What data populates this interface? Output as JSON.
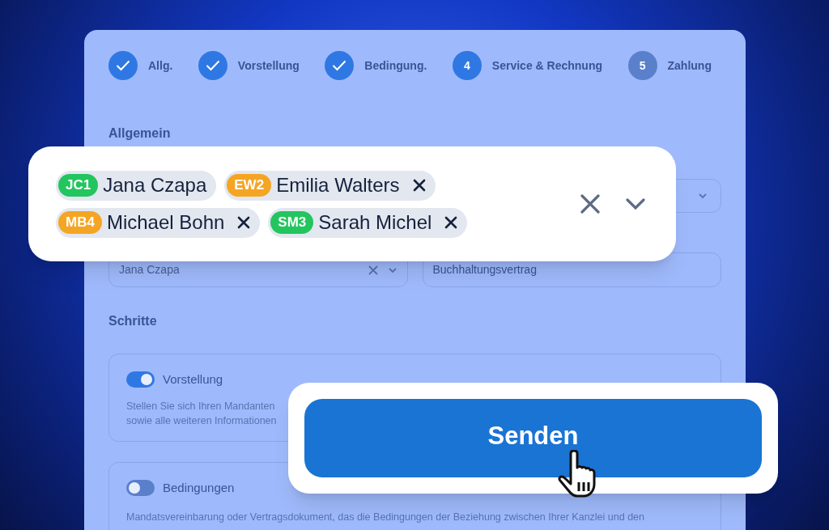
{
  "steps": [
    {
      "kind": "done",
      "label": "Allg."
    },
    {
      "kind": "done",
      "label": "Vorstellung"
    },
    {
      "kind": "done",
      "label": "Bedingung."
    },
    {
      "kind": "current",
      "number": "4",
      "label": "Service & Rechnung"
    },
    {
      "kind": "pending",
      "number": "5",
      "label": "Zahlung"
    }
  ],
  "general": {
    "heading": "Allgemein",
    "contact_field": {
      "value": "Jana Czapa"
    },
    "contract_field": {
      "value": "Buchhaltungsvertrag"
    }
  },
  "tag_select": {
    "tags": [
      {
        "code": "JC1",
        "name": "Jana Czapa",
        "color": "#22c55e",
        "removable": false
      },
      {
        "code": "EW2",
        "name": "Emilia Walters",
        "color": "#f5a524",
        "removable": true
      },
      {
        "code": "MB4",
        "name": "Michael Bohn",
        "color": "#f5a524",
        "removable": true
      },
      {
        "code": "SM3",
        "name": "Sarah Michel",
        "color": "#22c55e",
        "removable": true
      }
    ]
  },
  "steps_section": {
    "heading": "Schritte",
    "items": [
      {
        "label": "Vorstellung",
        "on": true,
        "description_lines": [
          "Stellen Sie sich Ihren Mandanten",
          "sowie alle weiteren Informationen"
        ]
      },
      {
        "label": "Bedingungen",
        "on": false,
        "description_lines": [
          "Mandatsvereinbarung oder Vertragsdokument, das die Bedingungen der Beziehung zwischen Ihrer Kanzlei und den"
        ]
      }
    ]
  },
  "submit_button": {
    "label": "Senden"
  }
}
